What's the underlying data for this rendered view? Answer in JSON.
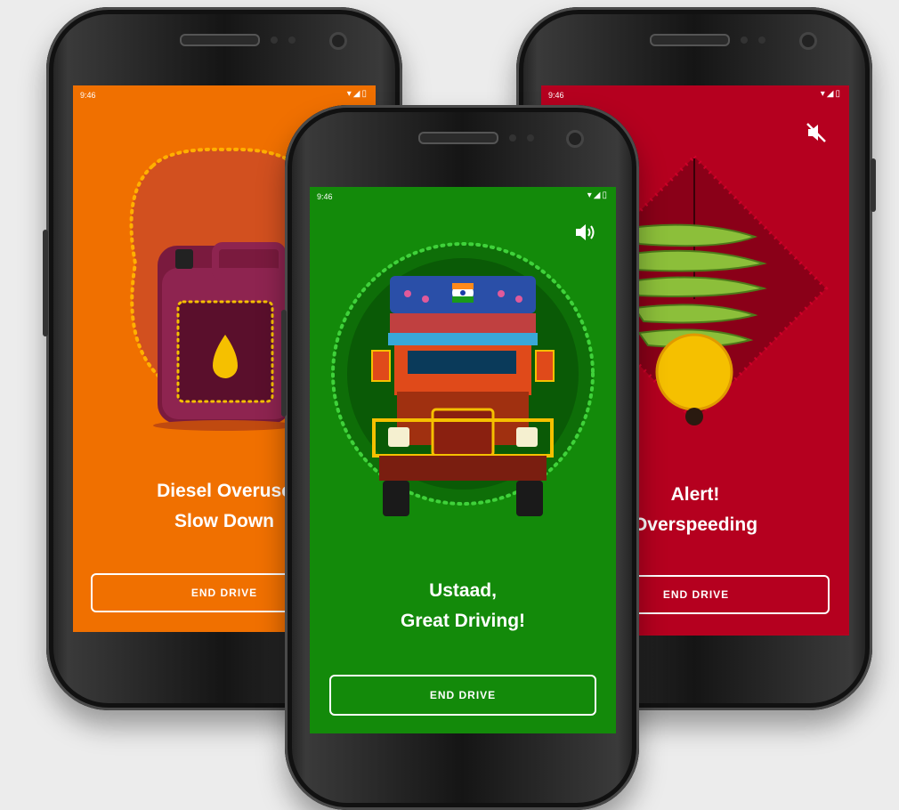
{
  "screens": {
    "left": {
      "time": "9:46",
      "status_icons": "▾◢▯",
      "line1": "Diesel Overuse",
      "line2": "Slow Down",
      "button": "END DRIVE",
      "bg_color": "#f07000",
      "illustration": "jerrycan-icon"
    },
    "right": {
      "time": "9:46",
      "status_icons": "▾◢▯",
      "line1": "Alert!",
      "line2": "Overspeeding",
      "button": "END DRIVE",
      "bg_color": "#b5001f",
      "sound_icon": "mute-icon",
      "illustration": "lemon-chilli-icon"
    },
    "center": {
      "time": "9:46",
      "status_icons": "▾◢▯",
      "line1": "Ustaad,",
      "line2": "Great Driving!",
      "button": "END DRIVE",
      "bg_color": "#138a0a",
      "sound_icon": "speaker-icon",
      "illustration": "truck-icon"
    }
  }
}
